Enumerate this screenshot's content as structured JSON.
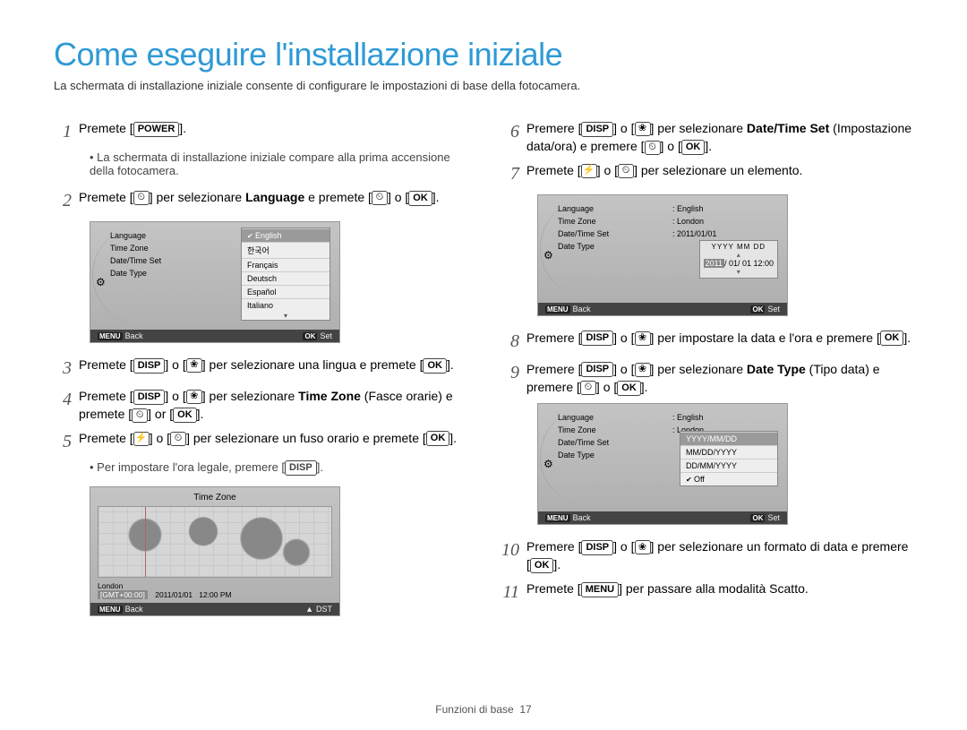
{
  "title": "Come eseguire l'installazione iniziale",
  "subtitle": "La schermata di installazione iniziale consente di configurare le impostazioni di base della fotocamera.",
  "buttons": {
    "power": "POWER",
    "disp": "DISP",
    "ok": "OK",
    "menu": "MENU",
    "flower": "❀",
    "timer": "⏲",
    "flash": "⚡"
  },
  "steps": {
    "s1": {
      "num": "1",
      "pre": "Premete [",
      "post": "]."
    },
    "s1_bullet": "La schermata di installazione iniziale compare alla prima accensione della fotocamera.",
    "s2": {
      "num": "2",
      "pre": "Premete [",
      "mid1": "] per selezionare ",
      "lang": "Language",
      "mid2": " e premete [",
      "mid3": "] o [",
      "post": "]."
    },
    "s3": {
      "num": "3",
      "pre": "Premete [",
      "mid1": "] o [",
      "mid2": "] per selezionare una lingua e premete [",
      "post": "]."
    },
    "s4": {
      "num": "4",
      "pre": "Premete [",
      "mid1": "] o [",
      "mid2": "] per selezionare ",
      "tz": "Time Zone",
      "mid3": " (Fasce orarie) e premete [",
      "mid4": "] or [",
      "post": "]."
    },
    "s5": {
      "num": "5",
      "pre": "Premete [",
      "mid1": "] o [",
      "mid2": "] per selezionare un fuso orario e premete [",
      "post": "]."
    },
    "s5_bullet": "Per impostare l'ora legale, premere [",
    "s5_bullet_end": "].",
    "s6": {
      "num": "6",
      "pre": "Premere [",
      "mid1": "] o [",
      "mid2": "] per selezionare ",
      "dts": "Date/Time Set",
      "mid3": " (Impostazione data/ora) e premere [",
      "mid4": "] o [",
      "post": "]."
    },
    "s7": {
      "num": "7",
      "pre": "Premete [",
      "mid1": "] o [",
      "mid2": "] per selezionare un elemento.",
      "post": ""
    },
    "s8": {
      "num": "8",
      "pre": "Premere [",
      "mid1": "] o [",
      "mid2": "] per impostare la data e l'ora e premere [",
      "post": "]."
    },
    "s9": {
      "num": "9",
      "pre": "Premere [",
      "mid1": "] o [",
      "mid2": "] per selezionare ",
      "dt": "Date Type",
      "mid3": " (Tipo data) e premere [",
      "mid4": "] o [",
      "post": "]."
    },
    "s10": {
      "num": "10",
      "pre": "Premere [",
      "mid1": "] o [",
      "mid2": "] per selezionare un formato di data e premere [",
      "post": "]."
    },
    "s11": {
      "num": "11",
      "pre": "Premete [",
      "mid1": "] per passare alla modalità Scatto."
    }
  },
  "screen1": {
    "left": [
      "Language",
      "Time Zone",
      "Date/Time Set",
      "Date Type"
    ],
    "langs": [
      "English",
      "한국어",
      "Français",
      "Deutsch",
      "Español",
      "Italiano"
    ],
    "back": "Back",
    "set": "Set"
  },
  "screen_map": {
    "title": "Time Zone",
    "city": "London",
    "gmt": "[GMT+00:00]",
    "date": "2011/01/01",
    "time": "12:00 PM",
    "back": "Back",
    "dst": "DST"
  },
  "screen2": {
    "rows": [
      {
        "k": "Language",
        "v": ": English"
      },
      {
        "k": "Time Zone",
        "v": ": London"
      },
      {
        "k": "Date/Time Set",
        "v": ": 2011/01/01"
      },
      {
        "k": "Date Type",
        "v": ""
      }
    ],
    "spin_hdr": "YYYY MM DD",
    "spin_val_a": "2011",
    "spin_val_b": "/ 01/ 01  12:00",
    "back": "Back",
    "set": "Set"
  },
  "screen3": {
    "rows": [
      {
        "k": "Language",
        "v": ": English"
      },
      {
        "k": "Time Zone",
        "v": ": London"
      },
      {
        "k": "Date/Time Set",
        "v": ""
      },
      {
        "k": "Date Type",
        "v": ""
      }
    ],
    "opts": [
      "YYYY/MM/DD",
      "MM/DD/YYYY",
      "DD/MM/YYYY",
      "Off"
    ],
    "back": "Back",
    "set": "Set"
  },
  "footer": {
    "section": "Funzioni di base",
    "page": "17"
  }
}
